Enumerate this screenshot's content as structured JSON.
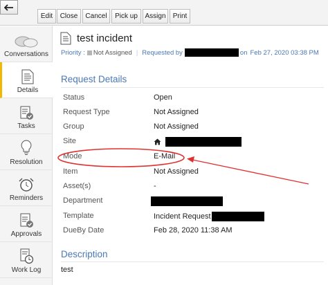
{
  "toolbar": {
    "back_label": "←",
    "buttons": [
      "Edit",
      "Close",
      "Cancel",
      "Pick up",
      "Assign",
      "Print"
    ]
  },
  "sidenav": {
    "items": [
      {
        "label": "Conversations",
        "icon": "chat-bubbles-icon"
      },
      {
        "label": "Details",
        "icon": "details-document-icon"
      },
      {
        "label": "Tasks",
        "icon": "tasks-checklist-icon"
      },
      {
        "label": "Resolution",
        "icon": "lightbulb-icon"
      },
      {
        "label": "Reminders",
        "icon": "alarm-clock-icon"
      },
      {
        "label": "Approvals",
        "icon": "approval-clipboard-icon"
      },
      {
        "label": "Work Log",
        "icon": "worklog-clock-icon"
      }
    ],
    "active": "Details"
  },
  "request": {
    "title": "test incident",
    "priority_label": "Priority :",
    "priority_value": "Not Assigned",
    "requested_by_label": "Requested by",
    "requested_on_label": "on",
    "requested_date": "Feb 27, 2020 03:38 PM"
  },
  "details": {
    "heading": "Request Details",
    "rows": [
      {
        "label": "Status",
        "value": "Open"
      },
      {
        "label": "Request Type",
        "value": "Not Assigned"
      },
      {
        "label": "Group",
        "value": "Not Assigned"
      },
      {
        "label": "Site",
        "value": ""
      },
      {
        "label": "Mode",
        "value": "E-Mail"
      },
      {
        "label": "Item",
        "value": "Not Assigned"
      },
      {
        "label": "Asset(s)",
        "value": "-"
      },
      {
        "label": "Department",
        "value": ""
      },
      {
        "label": "Template",
        "value": "Incident Request"
      },
      {
        "label": "DueBy Date",
        "value": "Feb 28, 2020 11:38 AM"
      }
    ]
  },
  "description": {
    "heading": "Description",
    "text": "test"
  },
  "colors": {
    "accent_blue": "#4a78b6",
    "active_nav_marker": "#f0b800",
    "annotation_red": "#e03030"
  }
}
